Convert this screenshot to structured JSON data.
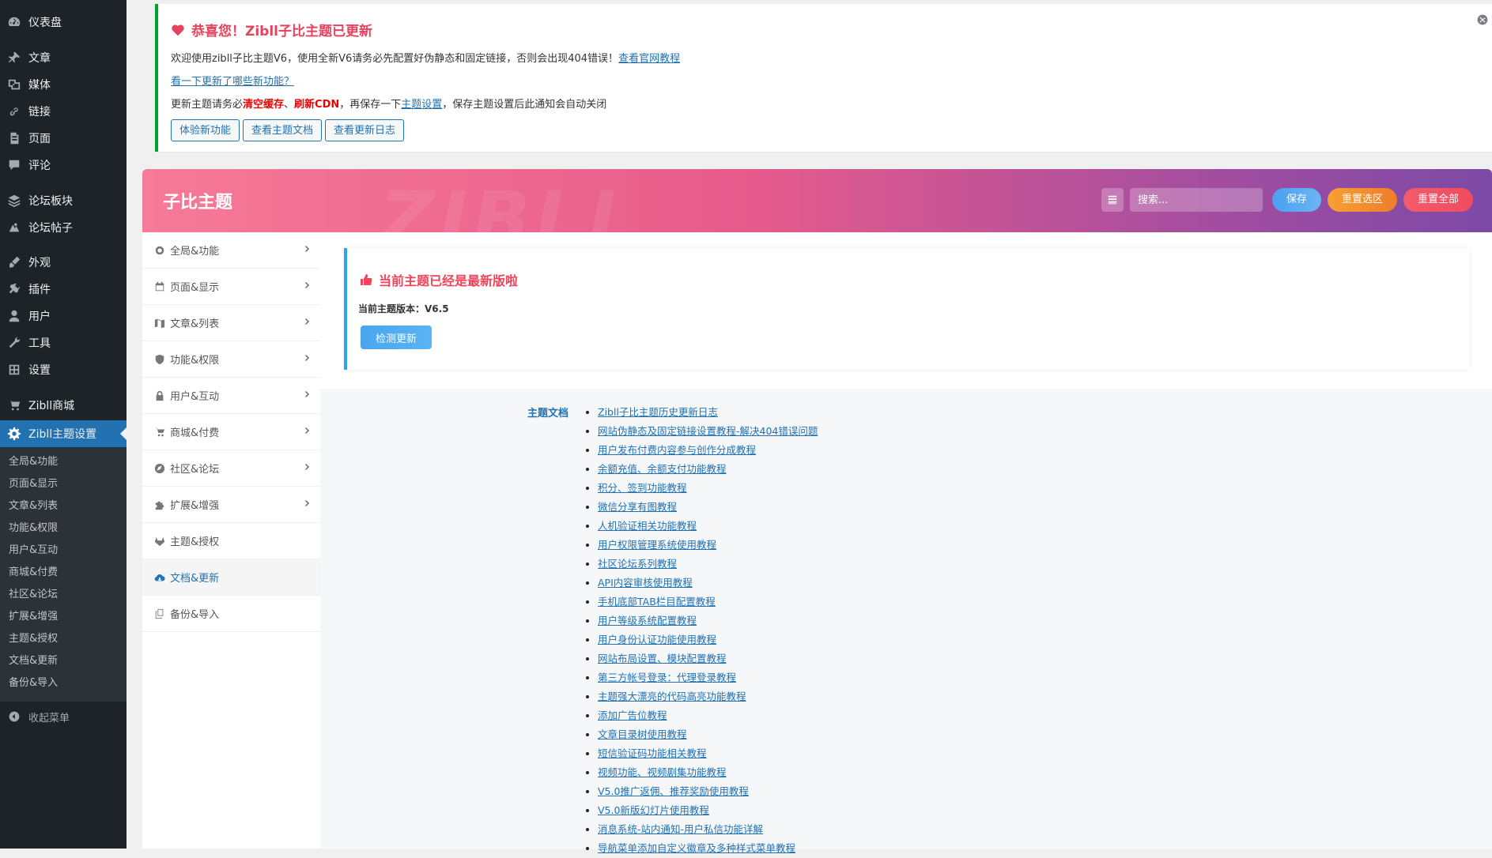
{
  "sidebar": {
    "items": [
      {
        "label": "仪表盘",
        "icon": "dashboard-icon"
      },
      {
        "label": "文章",
        "icon": "pin-icon"
      },
      {
        "label": "媒体",
        "icon": "media-icon"
      },
      {
        "label": "链接",
        "icon": "link-icon"
      },
      {
        "label": "页面",
        "icon": "page-icon"
      },
      {
        "label": "评论",
        "icon": "comment-icon"
      },
      {
        "label": "论坛板块",
        "icon": "forum-board-icon"
      },
      {
        "label": "论坛帖子",
        "icon": "forum-post-icon"
      },
      {
        "label": "外观",
        "icon": "brush-icon"
      },
      {
        "label": "插件",
        "icon": "plugin-icon"
      },
      {
        "label": "用户",
        "icon": "user-icon"
      },
      {
        "label": "工具",
        "icon": "wrench-icon"
      },
      {
        "label": "设置",
        "icon": "settings-icon"
      },
      {
        "label": "Zibll商城",
        "icon": "cart-icon"
      },
      {
        "label": "Zibll主题设置",
        "icon": "gear-icon"
      }
    ],
    "submenu": [
      "全局&功能",
      "页面&显示",
      "文章&列表",
      "功能&权限",
      "用户&互动",
      "商城&付费",
      "社区&论坛",
      "扩展&增强",
      "主题&授权",
      "文档&更新",
      "备份&导入"
    ],
    "collapse_label": "收起菜单"
  },
  "notice": {
    "title": "恭喜您！Zibll子比主题已更新",
    "line1_text": "欢迎使用zibll子比主题V6，使用全新V6请务必先配置好伪静态和固定链接，否则会出现404错误！",
    "line1_link": "查看官网教程",
    "line2_link": "看一下更新了哪些新功能？",
    "line3_a": "更新主题请务必",
    "line3_b": "清空缓存",
    "line3_c": "、",
    "line3_d": "刷新CDN",
    "line3_e": "，再保存一下",
    "line3_link": "主题设置",
    "line3_f": "，保存主题设置后此通知会自动关闭",
    "buttons": [
      "体验新功能",
      "查看主题文档",
      "查看更新日志"
    ]
  },
  "header": {
    "title": "子比主题",
    "watermark": "ZIBLL",
    "search_placeholder": "搜索...",
    "save": "保存",
    "reset_section": "重置选区",
    "reset_all": "重置全部"
  },
  "nav": {
    "items": [
      {
        "label": "全局&功能",
        "icon": "globe-icon"
      },
      {
        "label": "页面&显示",
        "icon": "calendar-icon"
      },
      {
        "label": "文章&列表",
        "icon": "map-icon"
      },
      {
        "label": "功能&权限",
        "icon": "shield-icon"
      },
      {
        "label": "用户&互动",
        "icon": "lock-icon"
      },
      {
        "label": "商城&付费",
        "icon": "cart-icon"
      },
      {
        "label": "社区&论坛",
        "icon": "compass-icon"
      },
      {
        "label": "扩展&增强",
        "icon": "puzzle-icon"
      },
      {
        "label": "主题&授权",
        "icon": "gitlab-icon"
      },
      {
        "label": "文档&更新",
        "icon": "cloud-download-icon"
      },
      {
        "label": "备份&导入",
        "icon": "copy-icon"
      }
    ],
    "active_index": 9
  },
  "content": {
    "latest_title": "当前主题已经是最新版啦",
    "version_label": "当前主题版本：V6.5",
    "check_button": "检测更新",
    "docs_label": "主题文档",
    "docs": [
      "Zibll子比主题历史更新日志",
      "网站伪静态及固定链接设置教程-解决404错误问题",
      "用户发布付费内容参与创作分成教程",
      "余额充值、余额支付功能教程",
      "积分、签到功能教程",
      "微信分享有图教程",
      "人机验证相关功能教程",
      "用户权限管理系统使用教程",
      "社区论坛系列教程",
      "API内容审核使用教程",
      "手机底部TAB栏目配置教程",
      "用户等级系统配置教程",
      "用户身份认证功能使用教程",
      "网站布局设置、模块配置教程",
      "第三方帐号登录：代理登录教程",
      "主题强大漂亮的代码高亮功能教程",
      "添加广告位教程",
      "文章目录树使用教程",
      "短信验证码功能相关教程",
      "视频功能、视频剧集功能教程",
      "V5.0推广返佣、推荐奖励使用教程",
      "V5.0新版幻灯片使用教程",
      "消息系统-站内通知-用户私信功能详解",
      "导航菜单添加自定义徽章及多种样式菜单教程"
    ]
  }
}
